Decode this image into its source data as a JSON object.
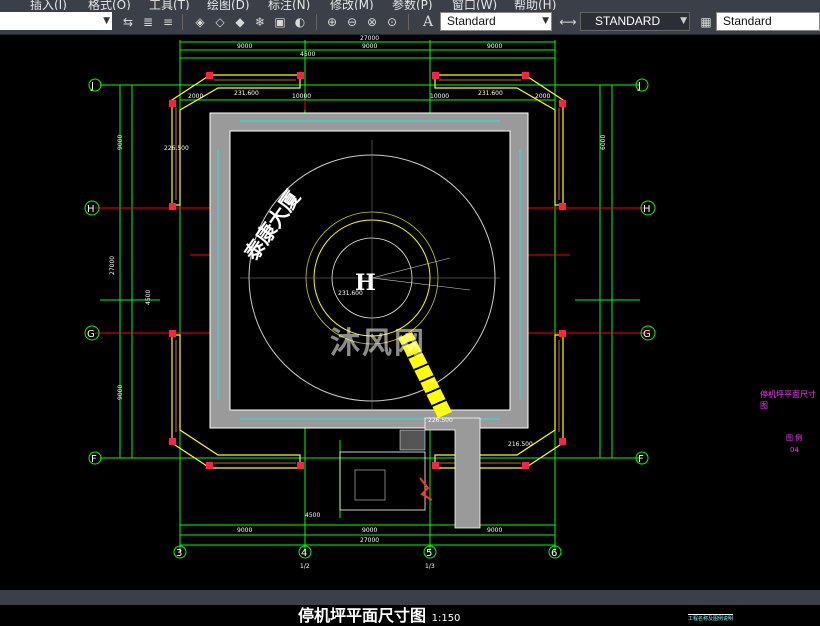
{
  "menu": {
    "items": [
      "插入(I)",
      "格式(O)",
      "工具(T)",
      "绘图(D)",
      "标注(N)",
      "修改(M)",
      "参数(P)",
      "窗口(W)",
      "帮助(H)"
    ]
  },
  "toolbar": {
    "text_style": "Standard",
    "dim_style": "STANDARD",
    "table_style": "Standard"
  },
  "drawing": {
    "title": "停机坪平面尺寸图",
    "scale": "1:150",
    "watermark": "沐风网",
    "helipad_letter": "H",
    "building_name": "泰康大厦",
    "grid_bubbles": [
      "J",
      "J",
      "H",
      "H",
      "G",
      "G",
      "F",
      "F",
      "3",
      "4",
      "5",
      "6",
      "1/2",
      "1/3"
    ],
    "dims_top": [
      "27000",
      "9000",
      "9000",
      "9000",
      "4500",
      "2000",
      "10000",
      "10000",
      "2000"
    ],
    "dims_bottom": [
      "9000",
      "9000",
      "9000",
      "27000",
      "4500"
    ],
    "dims_side": [
      "9000",
      "9000",
      "27000",
      "4500",
      "6000"
    ],
    "elevations": [
      "231.600",
      "231.600",
      "226.500",
      "231.600",
      "226.500",
      "216.500"
    ],
    "right_note": "停机坪平面尺寸图",
    "right_num1": "图 例",
    "right_num2": "04",
    "bottom_right_note": "工程名称及图例说明"
  },
  "colors": {
    "background": "#000000",
    "grid_line": "#00ff00",
    "axis_red": "#ff0000",
    "wall_yellow": "#ffff00",
    "cyan": "#00ffff",
    "magenta": "#ff33ff"
  }
}
